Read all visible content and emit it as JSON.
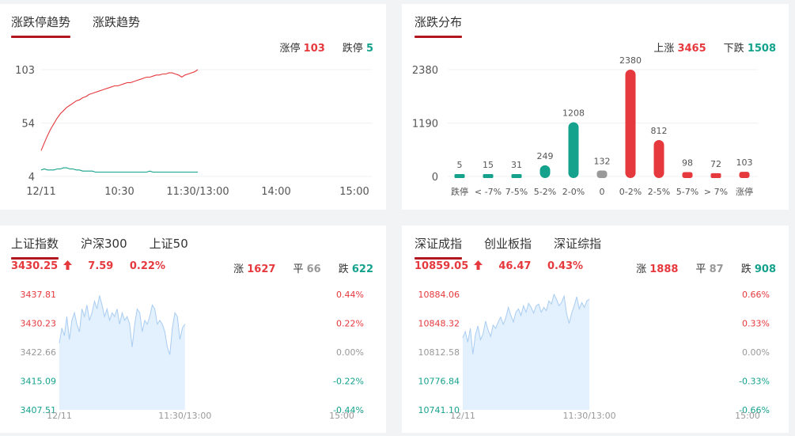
{
  "panels": {
    "trend": {
      "tabs": [
        "涨跌停趋势",
        "涨跌趋势"
      ],
      "limit_up_label": "涨停",
      "limit_up_value": "103",
      "limit_down_label": "跌停",
      "limit_down_value": "5"
    },
    "dist": {
      "tabs": [
        "涨跌分布"
      ],
      "up_label": "上涨",
      "up_value": "3465",
      "down_label": "下跌",
      "down_value": "1508"
    },
    "sh": {
      "tabs": [
        "上证指数",
        "沪深300",
        "上证50"
      ],
      "price": "3430.25",
      "change": "7.59",
      "pct": "0.22%",
      "up_label": "涨",
      "up_value": "1627",
      "flat_label": "平",
      "flat_value": "66",
      "down_label": "跌",
      "down_value": "622"
    },
    "sz": {
      "tabs": [
        "深证成指",
        "创业板指",
        "深证综指"
      ],
      "price": "10859.05",
      "change": "46.47",
      "pct": "0.43%",
      "up_label": "涨",
      "up_value": "1888",
      "flat_label": "平",
      "flat_value": "87",
      "down_label": "跌",
      "down_value": "908"
    }
  },
  "colors": {
    "up": "#e5393d",
    "down": "#14a28c",
    "flat": "#999999",
    "area_fill": "#e3f0fd",
    "area_line": "#a9cdf2",
    "accent": "#b2161e"
  },
  "chart_data": [
    {
      "type": "line",
      "yticks": [
        "103",
        "54",
        "4"
      ],
      "ylim": [
        4,
        103
      ],
      "xticks": [
        "12/11",
        "10:30",
        "11:30/13:00",
        "14:00",
        "15:00"
      ],
      "series": [
        {
          "name": "涨停",
          "color": "#e5393d",
          "values": [
            28,
            35,
            42,
            48,
            53,
            58,
            62,
            65,
            68,
            70,
            72,
            74,
            75,
            77,
            78,
            80,
            81,
            82,
            83,
            84,
            85,
            86,
            87,
            88,
            88,
            89,
            90,
            91,
            91,
            92,
            93,
            94,
            95,
            96,
            96,
            97,
            98,
            98,
            99,
            99,
            100,
            100,
            99,
            98,
            96,
            98,
            99,
            100,
            101,
            103
          ]
        },
        {
          "name": "跌停",
          "color": "#14a28c",
          "values": [
            10,
            11,
            10,
            10,
            10,
            11,
            11,
            12,
            12,
            11,
            11,
            10,
            10,
            9,
            9,
            9,
            9,
            8,
            8,
            8,
            8,
            8,
            8,
            8,
            8,
            8,
            8,
            8,
            8,
            8,
            8,
            8,
            8,
            8,
            9,
            8,
            8,
            8,
            8,
            8,
            8,
            8,
            8,
            8,
            8,
            8,
            8,
            8,
            8,
            8
          ]
        }
      ]
    },
    {
      "type": "bar",
      "categories": [
        "跌停",
        "< -7%",
        "7-5%",
        "5-2%",
        "2-0%",
        "0",
        "0-2%",
        "2-5%",
        "5-7%",
        "> 7%",
        "涨停"
      ],
      "values": [
        5,
        15,
        31,
        249,
        1208,
        132,
        2380,
        812,
        98,
        72,
        103
      ],
      "colors": [
        "#14a28c",
        "#14a28c",
        "#14a28c",
        "#14a28c",
        "#14a28c",
        "#999999",
        "#e5393d",
        "#e5393d",
        "#e5393d",
        "#e5393d",
        "#e5393d"
      ],
      "yticks": [
        "2380",
        "1190",
        "0"
      ],
      "ylim": [
        0,
        2380
      ]
    },
    {
      "type": "area",
      "yticks": [
        "3437.81",
        "3430.23",
        "3422.66",
        "3415.09",
        "3407.51"
      ],
      "yticks_right": [
        "0.44%",
        "0.22%",
        "0.00%",
        "-0.22%",
        "-0.44%"
      ],
      "ylim": [
        3407.51,
        3437.81
      ],
      "xticks": [
        "12/11",
        "11:30/13:00",
        "15:00"
      ],
      "values": [
        3425,
        3429,
        3427,
        3432,
        3426,
        3431,
        3433,
        3430,
        3428,
        3434,
        3432,
        3435,
        3431,
        3433,
        3436,
        3434,
        3437.5,
        3435,
        3432,
        3434,
        3431,
        3433,
        3432,
        3434,
        3430,
        3433,
        3431,
        3432,
        3430,
        3424,
        3430,
        3434,
        3433,
        3428,
        3431,
        3430,
        3432,
        3435,
        3434,
        3430,
        3431,
        3430,
        3428,
        3424,
        3422,
        3429,
        3433,
        3432,
        3426,
        3429,
        3430
      ],
      "series": [
        {
          "values": []
        }
      ]
    },
    {
      "type": "area",
      "yticks": [
        "10884.06",
        "10848.32",
        "10812.58",
        "10776.84",
        "10741.10"
      ],
      "yticks_right": [
        "0.66%",
        "0.33%",
        "0.00%",
        "-0.33%",
        "-0.66%"
      ],
      "ylim": [
        10741.1,
        10884.06
      ],
      "xticks": [
        "12/11",
        "11:30/13:00",
        "15:00"
      ],
      "values": [
        10830,
        10838,
        10825,
        10842,
        10810,
        10834,
        10845,
        10828,
        10835,
        10851,
        10840,
        10832,
        10846,
        10842,
        10850,
        10856,
        10847,
        10855,
        10868,
        10858,
        10850,
        10862,
        10866,
        10858,
        10870,
        10862,
        10873,
        10868,
        10861,
        10870,
        10872,
        10862,
        10868,
        10864,
        10876,
        10872,
        10884,
        10878,
        10870,
        10874,
        10882,
        10860,
        10848,
        10861,
        10870,
        10881,
        10866,
        10874,
        10868,
        10876,
        10878
      ],
      "series": [
        {
          "values": []
        }
      ]
    }
  ]
}
